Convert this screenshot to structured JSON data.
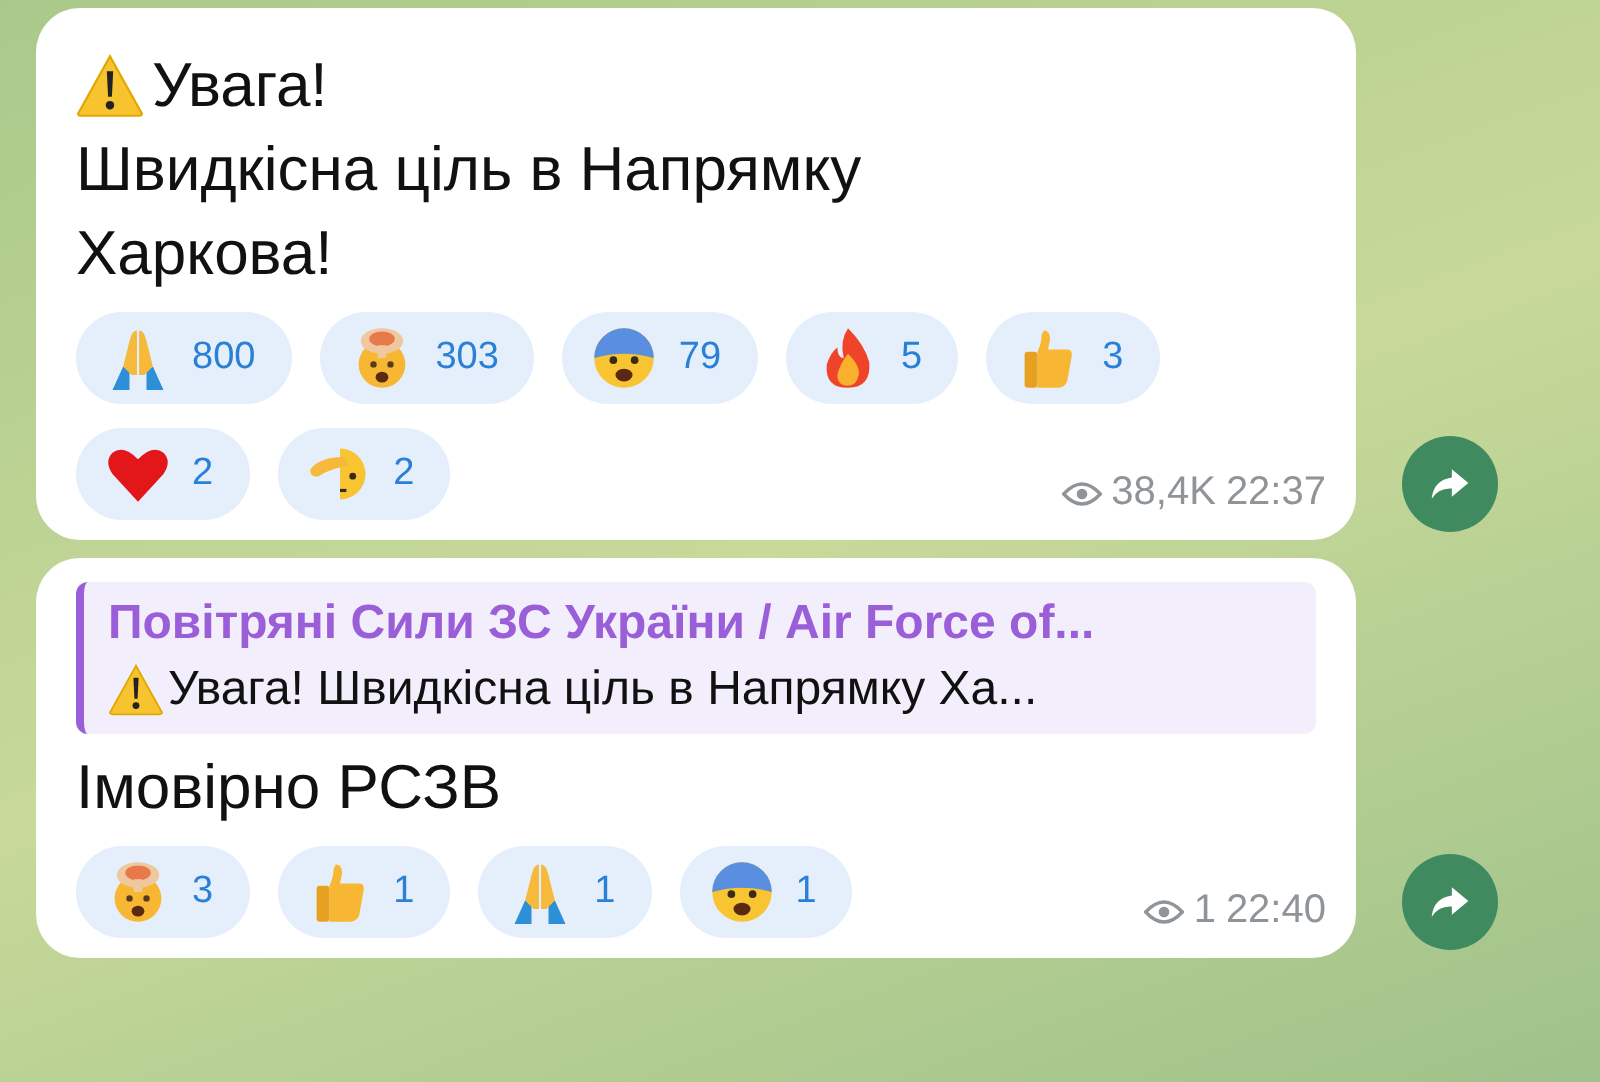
{
  "messages": [
    {
      "kind": "post",
      "heading": "Увага!",
      "text": "Швидкісна ціль в Напрямку Харкова!",
      "reactions": [
        {
          "kind": "pray",
          "count": "800"
        },
        {
          "kind": "explode",
          "count": "303"
        },
        {
          "kind": "fear",
          "count": "79"
        },
        {
          "kind": "fire",
          "count": "5"
        },
        {
          "kind": "thumbs",
          "count": "3"
        },
        {
          "kind": "heart",
          "count": "2"
        },
        {
          "kind": "salute",
          "count": "2"
        }
      ],
      "views": "38,4K",
      "time": "22:37"
    },
    {
      "kind": "reply",
      "reply": {
        "author": "Повітряні Сили ЗС України / Air Force of...",
        "text": "Увага! Швидкісна ціль в Напрямку Ха..."
      },
      "text": "Імовірно РСЗВ",
      "reactions": [
        {
          "kind": "explode",
          "count": "3"
        },
        {
          "kind": "thumbs",
          "count": "1"
        },
        {
          "kind": "pray",
          "count": "1"
        },
        {
          "kind": "fear",
          "count": "1"
        }
      ],
      "views": "1",
      "time": "22:40"
    }
  ]
}
